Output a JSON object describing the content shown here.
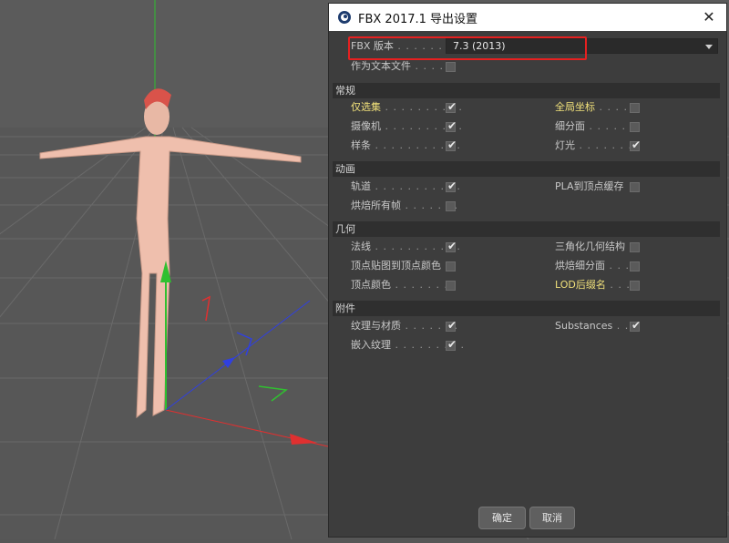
{
  "dialog": {
    "title": "FBX 2017.1 导出设置",
    "close_label": "✕",
    "fbx_version_label": "FBX 版本",
    "fbx_version_value": "7.3 (2013)",
    "text_file_label": "作为文本文件",
    "sections": {
      "general": "常规",
      "animation": "动画",
      "geometry": "几何",
      "extras": "附件"
    },
    "options": {
      "selection_only": {
        "label": "仅选集",
        "checked": true
      },
      "global_coords": {
        "label": "全局坐标",
        "checked": false
      },
      "cameras": {
        "label": "摄像机",
        "checked": true
      },
      "subdivision": {
        "label": "细分面",
        "checked": false
      },
      "splines": {
        "label": "样条",
        "checked": true
      },
      "lights": {
        "label": "灯光",
        "checked": true
      },
      "tracks": {
        "label": "轨道",
        "checked": true
      },
      "pla_cache": {
        "label": "PLA到顶点缓存",
        "checked": false
      },
      "bake_all_frames": {
        "label": "烘焙所有帧",
        "checked": false
      },
      "normals": {
        "label": "法线",
        "checked": true
      },
      "triangulate": {
        "label": "三角化几何结构",
        "checked": false
      },
      "vertex_map_to_color": {
        "label": "顶点贴图到顶点颜色",
        "checked": false
      },
      "bake_subdivision": {
        "label": "烘焙细分面",
        "checked": false
      },
      "vertex_colors": {
        "label": "顶点颜色",
        "checked": false
      },
      "lod_suffix": {
        "label": "LOD后缀名",
        "checked": false
      },
      "textures_materials": {
        "label": "纹理与材质",
        "checked": true
      },
      "substances": {
        "label": "Substances",
        "checked": true
      },
      "embed_textures": {
        "label": "嵌入纹理",
        "checked": true
      }
    },
    "text_file_checked": false,
    "ok_label": "确定",
    "cancel_label": "取消"
  },
  "colors": {
    "highlight_text": "#f0e07a",
    "annotation_box": "#e62020",
    "axis_x": "#e03030",
    "axis_y": "#30c030",
    "axis_z": "#3040e0"
  },
  "icons": [
    "cinema4d-app-icon",
    "close-icon",
    "dropdown-arrow-icon",
    "checkmark-icon"
  ]
}
